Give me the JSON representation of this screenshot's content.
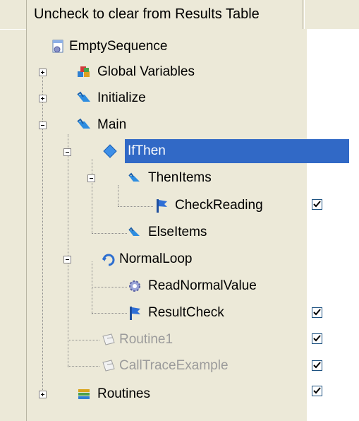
{
  "header": {
    "caption": "Uncheck to clear from Results Table"
  },
  "tree": {
    "root": "EmptySequence",
    "items": [
      {
        "label": "Global Variables",
        "icon": "variables-icon"
      },
      {
        "label": "Initialize",
        "icon": "stepgroup-icon"
      },
      {
        "label": "Main",
        "icon": "stepgroup-icon"
      },
      {
        "label": "IfThen",
        "icon": "diamond-icon",
        "selected": true
      },
      {
        "label": "ThenItems",
        "icon": "folder-step-icon"
      },
      {
        "label": "CheckReading",
        "icon": "flag-icon",
        "checked": true
      },
      {
        "label": "ElseItems",
        "icon": "folder-step-icon"
      },
      {
        "label": "NormalLoop",
        "icon": "loop-icon"
      },
      {
        "label": "ReadNormalValue",
        "icon": "gear-icon"
      },
      {
        "label": "ResultCheck",
        "icon": "flag-icon",
        "checked": true
      },
      {
        "label": "Routine1",
        "icon": "routine-icon",
        "disabled": true,
        "checked": true
      },
      {
        "label": "CallTraceExample",
        "icon": "routine-icon",
        "disabled": true,
        "checked": true
      },
      {
        "label": "Routines",
        "icon": "books-icon",
        "checked": true
      }
    ]
  },
  "colors": {
    "selection": "#3169c6",
    "panel": "#ece9d8",
    "disabled_text": "#9b9b9b"
  }
}
